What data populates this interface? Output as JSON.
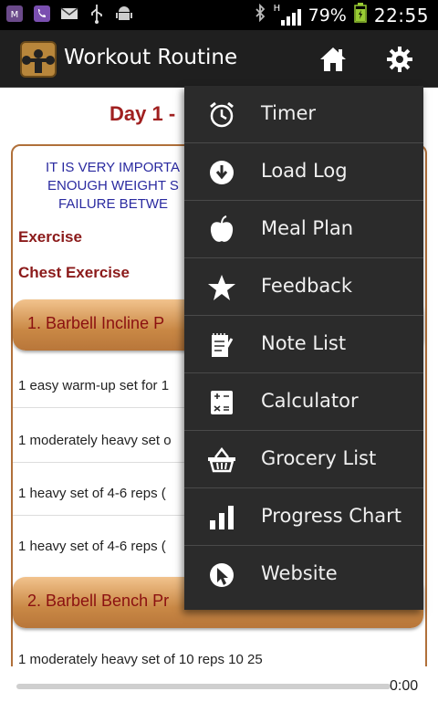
{
  "status_bar": {
    "battery_percent": "79%",
    "time": "22:55",
    "network_type": "H",
    "icons": [
      "antivirus-icon",
      "viber-icon",
      "mail-icon",
      "usb-icon",
      "android-icon",
      "bluetooth-icon",
      "signal-icon",
      "battery-icon"
    ]
  },
  "action_bar": {
    "title": "Workout Routine",
    "home_icon": "home-icon",
    "settings_icon": "gear-icon"
  },
  "content": {
    "day_title": "Day 1 - ",
    "warning_lines": [
      "IT IS VERY IMPORTA",
      "ENOUGH WEIGHT S",
      "FAILURE BETWE"
    ],
    "exercise_label": "Exercise",
    "chest_label": "Chest Exercise",
    "exercise_1": "1. Barbell Incline P",
    "sets": [
      "1 easy warm-up set for 1",
      "1 moderately heavy set o",
      "1 heavy set of 4-6 reps (",
      "1 heavy set of 4-6 reps ("
    ],
    "exercise_2": "2. Barbell Bench Pr",
    "partial_row": "1 moderately heavy set of 10 reps   10   25"
  },
  "media": {
    "time": "0:00"
  },
  "menu": {
    "items": [
      {
        "label": "Timer",
        "icon": "alarm-clock-icon"
      },
      {
        "label": "Load Log",
        "icon": "download-icon"
      },
      {
        "label": "Meal Plan",
        "icon": "apple-icon"
      },
      {
        "label": "Feedback",
        "icon": "star-icon"
      },
      {
        "label": "Note List",
        "icon": "notepad-icon"
      },
      {
        "label": "Calculator",
        "icon": "calculator-icon"
      },
      {
        "label": "Grocery List",
        "icon": "basket-icon"
      },
      {
        "label": "Progress Chart",
        "icon": "bar-chart-icon"
      },
      {
        "label": "Website",
        "icon": "cursor-icon"
      }
    ]
  },
  "colors": {
    "accent_red": "#a02020",
    "warning_blue": "#2a2aa0",
    "pill_orange": "#c98845",
    "menu_bg": "#2b2b2b"
  }
}
